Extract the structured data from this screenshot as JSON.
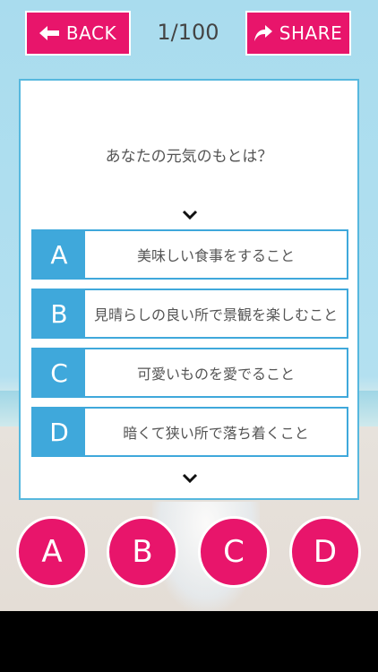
{
  "header": {
    "back_label": "BACK",
    "share_label": "SHARE",
    "counter": "1/100"
  },
  "question": "あなたの元気のもとは？",
  "options": [
    {
      "letter": "A",
      "text": "美味しい食事をすること"
    },
    {
      "letter": "B",
      "text": "見晴らしの良い所で景観を楽しむこと"
    },
    {
      "letter": "C",
      "text": "可愛いものを愛でること"
    },
    {
      "letter": "D",
      "text": "暗くて狭い所で落ち着くこと"
    }
  ],
  "answer_buttons": [
    "A",
    "B",
    "C",
    "D"
  ],
  "colors": {
    "accent": "#e8156b",
    "option_blue": "#3fa8db",
    "card_border": "#57b8de"
  }
}
